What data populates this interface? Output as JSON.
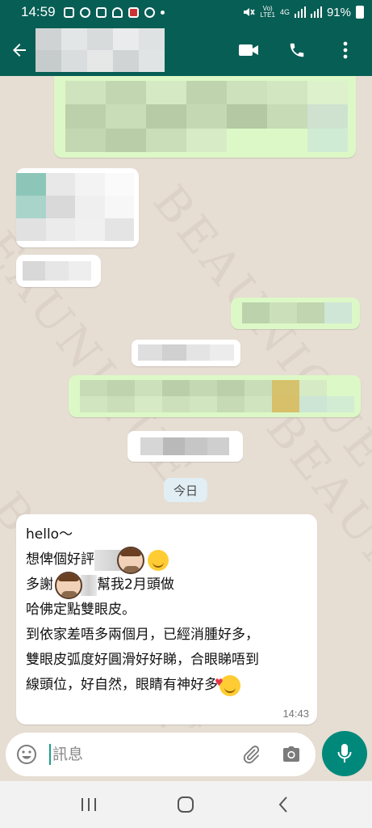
{
  "status_bar": {
    "time": "14:59",
    "network_top": "Vo)",
    "network_bottom": "LTE1",
    "network_gen": "4G",
    "battery": "91%"
  },
  "app_bar": {
    "icons": [
      "back-arrow-icon",
      "video-call-icon",
      "phone-icon",
      "more-options-icon"
    ]
  },
  "chat": {
    "watermark": "BEAUNIQUE",
    "date_chip": "今日",
    "message": {
      "lines": [
        "hello～",
        "想俾個好評",
        "多謝",
        "幫我2月頭做",
        "哈佛定點雙眼皮。",
        "到依家差唔多兩個月，已經消腫好多，",
        "雙眼皮弧度好圓滑好好睇，合眼睇唔到",
        "線頭位，好自然，眼睛有神好多"
      ],
      "time": "14:43"
    }
  },
  "input": {
    "placeholder": "訊息"
  },
  "colors": {
    "header": "#075e54",
    "outgoing_bubble": "#dcf8c6",
    "incoming_bubble": "#ffffff",
    "mic_button": "#00897b",
    "chat_background": "#e6ddd3"
  }
}
